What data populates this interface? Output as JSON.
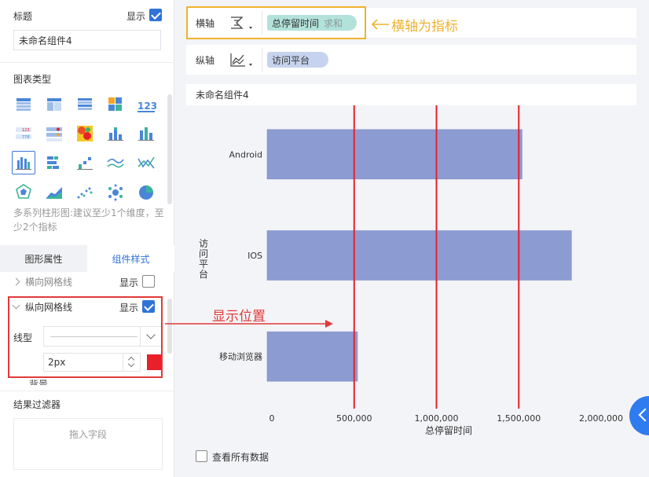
{
  "left_panel": {
    "title_section": {
      "label": "标题",
      "show_label": "显示",
      "show_checked": true,
      "title_value": "未命名组件4"
    },
    "chart_type_section": {
      "label": "图表类型",
      "icons": [
        [
          "table-icon",
          "cross-table-icon",
          "group-table-icon",
          "color-grid-icon",
          "kpi-number-icon"
        ],
        [
          "kpi-table-icon",
          "dot-table-icon",
          "heatmap-icon",
          "stacked-bar-icon",
          "column-chart-icon"
        ],
        [
          "multi-series-bar-icon",
          "horizontal-bar-icon",
          "scatter-bar-icon",
          "area-line-icon",
          "line-chart-icon"
        ],
        [
          "radar-icon",
          "area-chart-icon",
          "scatter-icon",
          "bubble-icon",
          "pie-icon"
        ]
      ],
      "hint": "多系列柱形图:建议至少1个维度，至少2个指标"
    },
    "tabs": {
      "graph_props": "图形属性",
      "component_style": "组件样式"
    },
    "h_gridline": {
      "label": "横向网格线",
      "show_label": "显示",
      "checked": false
    },
    "v_gridline": {
      "label": "纵向网格线",
      "show_label": "显示",
      "checked": true
    },
    "line_type_label": "线型",
    "width_value": "2px",
    "line_color": "#e8202a",
    "cut_label": "背景",
    "filter_section": {
      "label": "结果过滤器",
      "drop_hint": "拖入字段"
    }
  },
  "x_axis": {
    "label": "横轴",
    "field": "总停留时间",
    "agg": "求和"
  },
  "y_axis": {
    "label": "纵轴",
    "field": "访问平台"
  },
  "annotations": {
    "x_axis_note": "横轴为指标",
    "position_note": "显示位置"
  },
  "chart_title": "未命名组件4",
  "show_all_label": "查看所有数据",
  "chart_data": {
    "type": "bar",
    "orientation": "horizontal",
    "categories": [
      "Android",
      "IOS",
      "移动浏览器"
    ],
    "values": [
      1520000,
      1820000,
      520000
    ],
    "xlabel": "总停留时间",
    "ylabel": "访问平台",
    "xlim": [
      0,
      2000000
    ],
    "x_ticks": [
      0,
      500000,
      1000000,
      1500000,
      2000000
    ],
    "x_tick_labels": [
      "0",
      "500,000",
      "1,000,000",
      "1,500,000",
      "2,000,000"
    ],
    "gridlines": {
      "vertical": true,
      "horizontal": false
    },
    "bar_color": "#8d9bd3",
    "grid_color": "#e8202a"
  }
}
